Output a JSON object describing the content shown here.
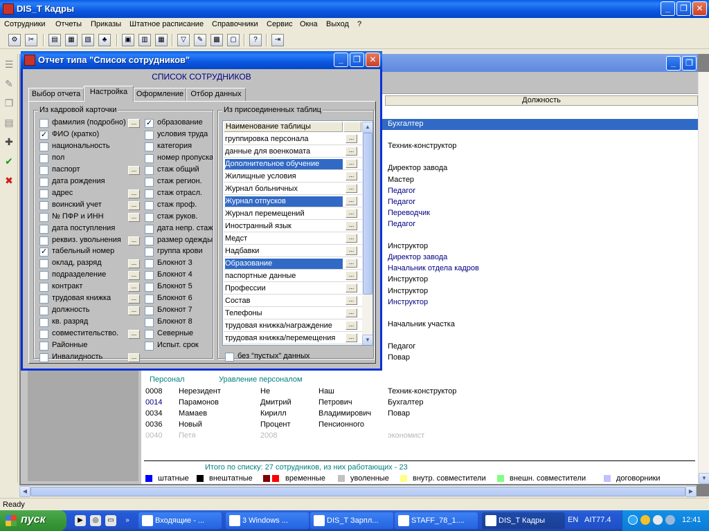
{
  "window": {
    "title": "DIS_T Кадры",
    "min": "_",
    "max": "❐",
    "close": "✕"
  },
  "menu": [
    "Сотрудники",
    "Отчеты",
    "Приказы",
    "Штатное расписание",
    "Справочники",
    "Сервис",
    "Окна",
    "Выход",
    "?"
  ],
  "toolbar_icons": [
    "users-icon",
    "tools-icon",
    "report-icon",
    "table-icon",
    "document-icon",
    "tree-icon",
    "doc2-icon",
    "book-icon",
    "grid-icon",
    "filter-icon",
    "edit-icon",
    "calculator-icon",
    "window-icon",
    "help-icon",
    "exit-icon"
  ],
  "grid": {
    "col_position": "Должность",
    "rows_top": [
      {
        "pos": "Бухгалтер",
        "sel": true
      },
      {
        "pos": "",
        "sel": false
      },
      {
        "pos": "Техник-конструктор",
        "sel": false
      },
      {
        "pos": "",
        "sel": false
      },
      {
        "pos": "Директор завода",
        "sel": false
      },
      {
        "pos": "Мастер",
        "sel": false
      },
      {
        "pos": "Педагог",
        "sel": false,
        "blue": true
      },
      {
        "pos": "Педагог",
        "sel": false,
        "blue": true
      },
      {
        "pos": "Переводчик",
        "sel": false,
        "blue": true
      },
      {
        "pos": "Педагог",
        "sel": false,
        "blue": true
      },
      {
        "pos": "",
        "sel": false
      },
      {
        "pos": "Инструктор",
        "sel": false
      },
      {
        "pos": "Директор завода",
        "sel": false,
        "blue": true
      },
      {
        "pos": "Начальник отдела кадров",
        "sel": false,
        "blue": true
      },
      {
        "pos": "Инструктор",
        "sel": false
      },
      {
        "pos": "Инструктор",
        "sel": false
      },
      {
        "pos": "Инструктор",
        "sel": false,
        "blue": true
      },
      {
        "pos": "",
        "sel": false
      },
      {
        "pos": "Начальник участка",
        "sel": false
      },
      {
        "pos": "",
        "sel": false
      },
      {
        "pos": "Педагог",
        "sel": false
      },
      {
        "pos": "Повар",
        "sel": false
      }
    ],
    "group_label": "Персонал",
    "group_dept": "Уравление персоналом",
    "rows_bottom": [
      {
        "num": "0008",
        "last": "Нерезидент",
        "first": "Не",
        "middle": "Наш",
        "pos": "Техник-конструктор",
        "style": ""
      },
      {
        "num": "0014",
        "last": "Парамонов",
        "first": "Дмитрий",
        "middle": "Петрович",
        "pos": "Бухгалтер",
        "style": "blue"
      },
      {
        "num": "0034",
        "last": "Мамаев",
        "first": "Кирилл",
        "middle": "Владимирович",
        "pos": "Повар",
        "style": ""
      },
      {
        "num": "0036",
        "last": "Новый",
        "first": "Процент",
        "middle": "Пенсионного",
        "pos": "",
        "style": ""
      },
      {
        "num": "0040",
        "last": "Петя",
        "first": "2008",
        "middle": "",
        "pos": "экономист",
        "style": "gray"
      }
    ],
    "total": "Итого по списку: 27 сотрудников, из них работающих - 23",
    "legend": [
      {
        "label": "штатные",
        "color": "#0000ff"
      },
      {
        "label": "внештатные",
        "color": "#000000"
      },
      {
        "label": "временные",
        "color": "#800000",
        "color2": "#ff0000"
      },
      {
        "label": "уволенные",
        "color": "#c0c0c0"
      },
      {
        "label": "внутр. совместители",
        "color": "#ffff80"
      },
      {
        "label": "внешн. совместители",
        "color": "#80ff80"
      },
      {
        "label": "договорники",
        "color": "#c0c0ff"
      }
    ]
  },
  "dialog": {
    "title": "Отчет типа \"Список сотрудников\"",
    "caption": "СПИСОК СОТРУДНИКОВ",
    "tabs": [
      "Выбор отчета",
      "Настройка",
      "Оформление",
      "Отбор данных"
    ],
    "active_tab": 1,
    "group_card": "Из кадровой карточки",
    "group_tables": "Из присоединенных таблиц",
    "col1": [
      {
        "label": "фамилия (подробно)",
        "checked": false,
        "dots": true
      },
      {
        "label": "ФИО (кратко)",
        "checked": true,
        "dots": false
      },
      {
        "label": "национальность",
        "checked": false,
        "dots": false
      },
      {
        "label": "пол",
        "checked": false,
        "dots": false
      },
      {
        "label": "паспорт",
        "checked": false,
        "dots": true
      },
      {
        "label": "дата рождения",
        "checked": false,
        "dots": false
      },
      {
        "label": "адрес",
        "checked": false,
        "dots": true
      },
      {
        "label": "воинский учет",
        "checked": false,
        "dots": true
      },
      {
        "label": "№ ПФР и ИНН",
        "checked": false,
        "dots": true
      },
      {
        "label": "дата поступления",
        "checked": false,
        "dots": false
      },
      {
        "label": "реквиз. увольнения",
        "checked": false,
        "dots": true
      },
      {
        "label": "табельный номер",
        "checked": true,
        "dots": false
      },
      {
        "label": "оклад, разряд",
        "checked": false,
        "dots": true
      },
      {
        "label": "подразделение",
        "checked": false,
        "dots": true
      },
      {
        "label": "контракт",
        "checked": false,
        "dots": true
      },
      {
        "label": "трудовая книжка",
        "checked": false,
        "dots": true
      },
      {
        "label": "должность",
        "checked": false,
        "dots": true
      },
      {
        "label": "кв. разряд",
        "checked": false,
        "dots": false
      },
      {
        "label": "совместительство.",
        "checked": false,
        "dots": true
      },
      {
        "label": "Районные",
        "checked": false,
        "dots": false
      },
      {
        "label": "Инвалидность",
        "checked": false,
        "dots": true
      }
    ],
    "col2": [
      {
        "label": "образование",
        "checked": true
      },
      {
        "label": "условия труда",
        "checked": false
      },
      {
        "label": "категория",
        "checked": false
      },
      {
        "label": "номер пропуска",
        "checked": false
      },
      {
        "label": "стаж общий",
        "checked": false
      },
      {
        "label": "стаж регион.",
        "checked": false
      },
      {
        "label": "стаж отрасл.",
        "checked": false
      },
      {
        "label": "стаж проф.",
        "checked": false
      },
      {
        "label": "стаж руков.",
        "checked": false
      },
      {
        "label": "дата непр. стажа",
        "checked": false
      },
      {
        "label": "размер одежды",
        "checked": false
      },
      {
        "label": "группа крови",
        "checked": false
      },
      {
        "label": "Блокнот 3",
        "checked": false
      },
      {
        "label": "Блокнот 4",
        "checked": false
      },
      {
        "label": "Блокнот 5",
        "checked": false
      },
      {
        "label": "Блокнот 6",
        "checked": false
      },
      {
        "label": "Блокнот 7",
        "checked": false
      },
      {
        "label": "Блокнот 8",
        "checked": false
      },
      {
        "label": "Северные",
        "checked": false
      },
      {
        "label": "Испыт. срок",
        "checked": false
      }
    ],
    "table_header": "Наименование таблицы",
    "tables": [
      {
        "name": "группировка персонала",
        "sel": false
      },
      {
        "name": "данные для военкомата",
        "sel": false
      },
      {
        "name": "Дополнительное обучение",
        "sel": true
      },
      {
        "name": "Жилищные условия",
        "sel": false
      },
      {
        "name": "Журнал больничных",
        "sel": false
      },
      {
        "name": "Журнал отпусков",
        "sel": true
      },
      {
        "name": "Журнал перемещений",
        "sel": false
      },
      {
        "name": "Иностранный язык",
        "sel": false
      },
      {
        "name": "Медст",
        "sel": false
      },
      {
        "name": "Надбавки",
        "sel": false
      },
      {
        "name": "Образование",
        "sel": true
      },
      {
        "name": "паспортные данные",
        "sel": false
      },
      {
        "name": "Профессии",
        "sel": false
      },
      {
        "name": "Состав",
        "sel": false
      },
      {
        "name": "Телефоны",
        "sel": false
      },
      {
        "name": "трудовая книжка/награждение",
        "sel": false
      },
      {
        "name": "трудовая книжка/перемещения",
        "sel": false
      }
    ],
    "no_empty_label": "без \"пустых\" данных"
  },
  "status": "Ready",
  "taskbar": {
    "start": "пуск",
    "tasks": [
      {
        "label": "Входящие - ...",
        "active": false
      },
      {
        "label": "3 Windows ...",
        "active": false
      },
      {
        "label": "DIS_T Зарпл...",
        "active": false
      },
      {
        "label": "STAFF_78_1....",
        "active": false
      },
      {
        "label": "DIS_T Кадры",
        "active": true
      }
    ],
    "lang": "EN",
    "ait": "AIT77.4",
    "clock": "12:41"
  }
}
